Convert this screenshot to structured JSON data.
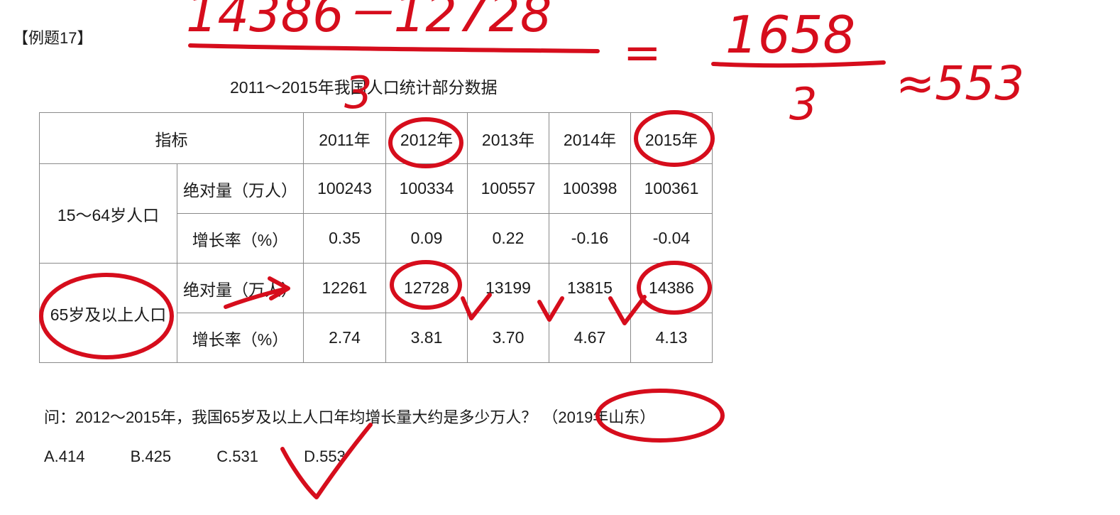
{
  "example_label": "【例题17】",
  "table": {
    "title": "2011～2015年我国人口统计部分数据",
    "header": {
      "indicator": "指标",
      "years": [
        "2011年",
        "2012年",
        "2013年",
        "2014年",
        "2015年"
      ]
    },
    "groups": [
      {
        "name": "15～64岁人口",
        "rows": [
          {
            "metric": "绝对量（万人）",
            "values": [
              "100243",
              "100334",
              "100557",
              "100398",
              "100361"
            ]
          },
          {
            "metric": "增长率（%）",
            "values": [
              "0.35",
              "0.09",
              "0.22",
              "-0.16",
              "-0.04"
            ]
          }
        ]
      },
      {
        "name": "65岁及以上人口",
        "rows": [
          {
            "metric": "绝对量（万人）",
            "values": [
              "12261",
              "12728",
              "13199",
              "13815",
              "14386"
            ]
          },
          {
            "metric": "增长率（%）",
            "values": [
              "2.74",
              "3.81",
              "3.70",
              "4.67",
              "4.13"
            ]
          }
        ]
      }
    ]
  },
  "question": {
    "text": "问：2012～2015年，我国65岁及以上人口年均增长量大约是多少万人？",
    "source": "（2019年山东）"
  },
  "options": [
    "A.414",
    "B.425",
    "C.531",
    "D.553"
  ],
  "annotations": {
    "color": "#d60d1c",
    "numerator": "14386－12728",
    "denominator_left": "3",
    "eq1": "=",
    "numerator_right": "1658",
    "denominator_right": "3",
    "result": "≈553"
  }
}
